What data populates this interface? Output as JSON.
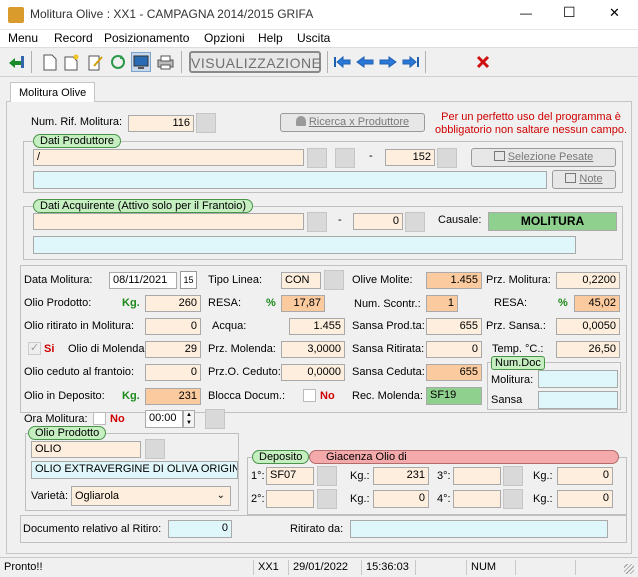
{
  "window": {
    "title": "Molitura Olive : XX1 - CAMPAGNA 2014/2015 GRIFA",
    "minimize": "—",
    "maximize": "☐",
    "close": "✕"
  },
  "menu": [
    "Menu",
    "Record",
    "Posizionamento",
    "Opzioni",
    "Help",
    "Uscita"
  ],
  "toolbar": {
    "view_mode": "VISUALIZZAZIONE"
  },
  "tab": {
    "label": "Molitura Olive"
  },
  "header": {
    "num_rif_label": "Num. Rif. Molitura:",
    "num_rif_value": "116",
    "search_button": "Ricerca x Produttore",
    "warning": "Per un perfetto uso del programma è obbligatorio non saltare nessun campo."
  },
  "produttore": {
    "title": "Dati Produttore",
    "name": "/",
    "dash": "-",
    "code": "152",
    "select_button": "Selezione Pesate",
    "note_button": "Note"
  },
  "acquirente": {
    "title": "Dati Acquirente (Attivo solo per il Frantoio)",
    "dash": "-",
    "code": "0",
    "causale_label": "Causale:",
    "causale_value": "MOLITURA"
  },
  "col1": {
    "data_label": "Data Molitura:",
    "data_value": "08/11/2021",
    "calendar_glyph": "15",
    "olio_prod_label": "Olio Prodotto:",
    "olio_prod_unit": "Kg.",
    "olio_prod_value": "260",
    "olio_rit_label": "Olio ritirato in Molitura:",
    "olio_rit_value": "0",
    "si_label": "Si",
    "molenda_label": "Olio di Molenda:",
    "molenda_value": "29",
    "ceduto_label": "Olio ceduto al frantoio:",
    "ceduto_value": "0",
    "deposito_label": "Olio in Deposito:",
    "deposito_unit": "Kg.",
    "deposito_value": "231",
    "ora_label": "Ora Molitura:",
    "ora_no": "No",
    "ora_value": "00:00"
  },
  "col2": {
    "tipo_label": "Tipo Linea:",
    "tipo_value": "CON",
    "resa_label": "RESA:",
    "resa_unit": "%",
    "resa_value": "17,87",
    "acqua_label": "Acqua:",
    "acqua_value": "1.455",
    "prz_molenda_label": "Prz. Molenda:",
    "prz_molenda_value": "3,0000",
    "prz_ceduto_label": "Prz.O. Ceduto:",
    "prz_ceduto_value": "0,0000",
    "blocca_label": "Blocca Docum.:",
    "blocca_no": "No"
  },
  "col3": {
    "olive_label": "Olive Molite:",
    "olive_value": "1.455",
    "scontr_label": "Num. Scontr.:",
    "scontr_value": "1",
    "sansa_prod_label": "Sansa Prod.ta:",
    "sansa_prod_value": "655",
    "sansa_rit_label": "Sansa Ritirata:",
    "sansa_rit_value": "0",
    "sansa_ced_label": "Sansa Ceduta:",
    "sansa_ced_value": "655",
    "rec_label": "Rec. Molenda:",
    "rec_value": "SF19"
  },
  "col4": {
    "prz_mol_label": "Prz. Molitura:",
    "prz_mol_value": "0,2200",
    "resa_label": "RESA:",
    "resa_unit": "%",
    "resa_value": "45,02",
    "prz_sansa_label": "Prz. Sansa.:",
    "prz_sansa_value": "0,0050",
    "temp_label": "Temp. °C.:",
    "temp_value": "26,50",
    "numdoc_title": "Num.Doc",
    "numdoc_molitura_label": "Molitura:",
    "numdoc_sansa_label": "Sansa"
  },
  "olio": {
    "title": "Olio Prodotto",
    "code": "OLIO",
    "description": "OLIO EXTRAVERGINE DI OLIVA ORIGINE",
    "varieta_label": "Varietà:",
    "varieta_value": "Ogliarola"
  },
  "deposito": {
    "title": "Deposito",
    "giacenza_title": "Giacenza Olio di",
    "rows": [
      {
        "label": "1°:",
        "code": "SF07",
        "kg_label": "Kg.:",
        "kg": "231",
        "label2": "3°:",
        "kg_label2": "Kg.:",
        "kg2": "0"
      },
      {
        "label": "2°:",
        "code": "",
        "kg_label": "Kg.:",
        "kg": "0",
        "label2": "4°:",
        "kg_label2": "Kg.:",
        "kg2": "0"
      }
    ]
  },
  "footer": {
    "doc_label": "Documento relativo al Ritiro:",
    "doc_value": "0",
    "ritirato_label": "Ritirato da:"
  },
  "status": {
    "message": "Pronto!!",
    "user": "XX1",
    "date": "29/01/2022",
    "time": "15:36:03",
    "num": "NUM"
  },
  "colors": {
    "accent": "#8fd08f",
    "peach": "#fdeedd",
    "orange": "#fbcb9f",
    "cyan": "#dff7fa"
  }
}
